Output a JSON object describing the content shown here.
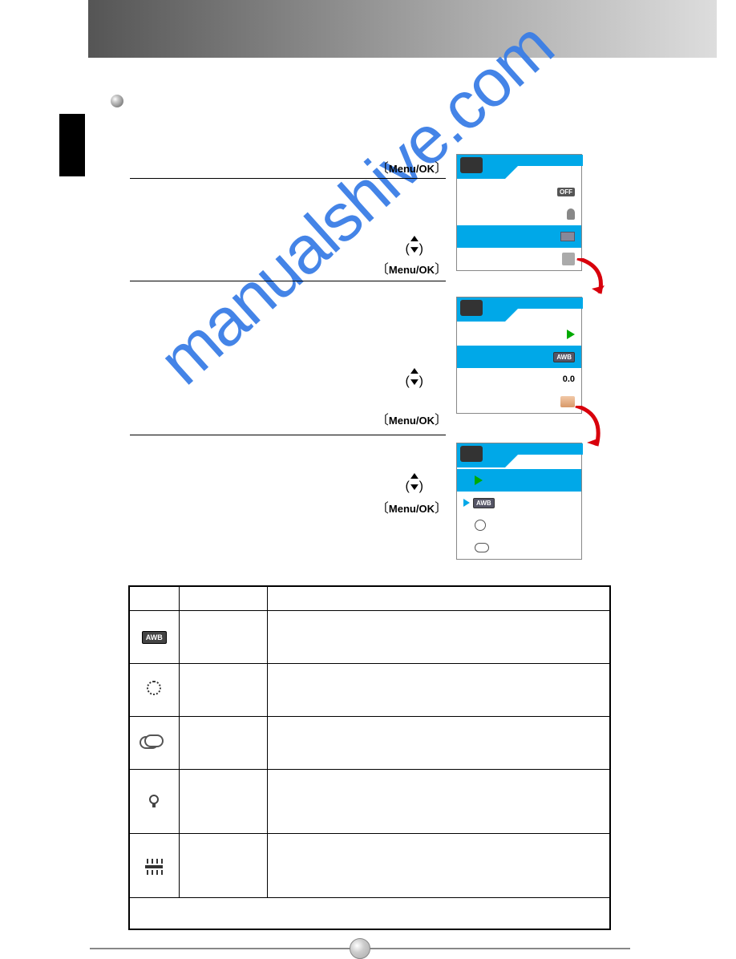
{
  "step1": {
    "menuok": "Menu/OK"
  },
  "step2": {
    "menuok": "Menu/OK"
  },
  "step3": {
    "menuok": "Menu/OK"
  },
  "step4": {
    "menuok": "Menu/OK"
  },
  "screens": {
    "s1": {
      "off": "OFF"
    },
    "s2": {
      "awb": "AWB",
      "ev": "0.0"
    },
    "s3": {
      "awb": "AWB"
    }
  },
  "table": {
    "awb_label": "AWB"
  }
}
